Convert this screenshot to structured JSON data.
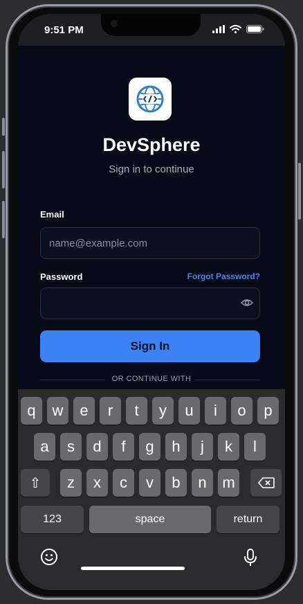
{
  "status": {
    "time": "9:51 PM"
  },
  "app": {
    "title": "DevSphere",
    "subtitle": "Sign in to continue"
  },
  "form": {
    "email_label": "Email",
    "email_placeholder": "name@example.com",
    "email_value": "",
    "password_label": "Password",
    "password_value": "",
    "forgot_label": "Forgot Password?",
    "signin_label": "Sign In",
    "divider_label": "OR CONTINUE WITH"
  },
  "keyboard": {
    "row1": [
      "q",
      "w",
      "e",
      "r",
      "t",
      "y",
      "u",
      "i",
      "o",
      "p"
    ],
    "row2": [
      "a",
      "s",
      "d",
      "f",
      "g",
      "h",
      "j",
      "k",
      "l"
    ],
    "row3": [
      "z",
      "x",
      "c",
      "v",
      "b",
      "n",
      "m"
    ],
    "shift_label": "⇧",
    "numbers_label": "123",
    "space_label": "space",
    "return_label": "return"
  },
  "colors": {
    "accent": "#3c82f6",
    "link": "#4a86f3",
    "background": "#060b17",
    "keyboard_bg": "#2b2b2d"
  }
}
